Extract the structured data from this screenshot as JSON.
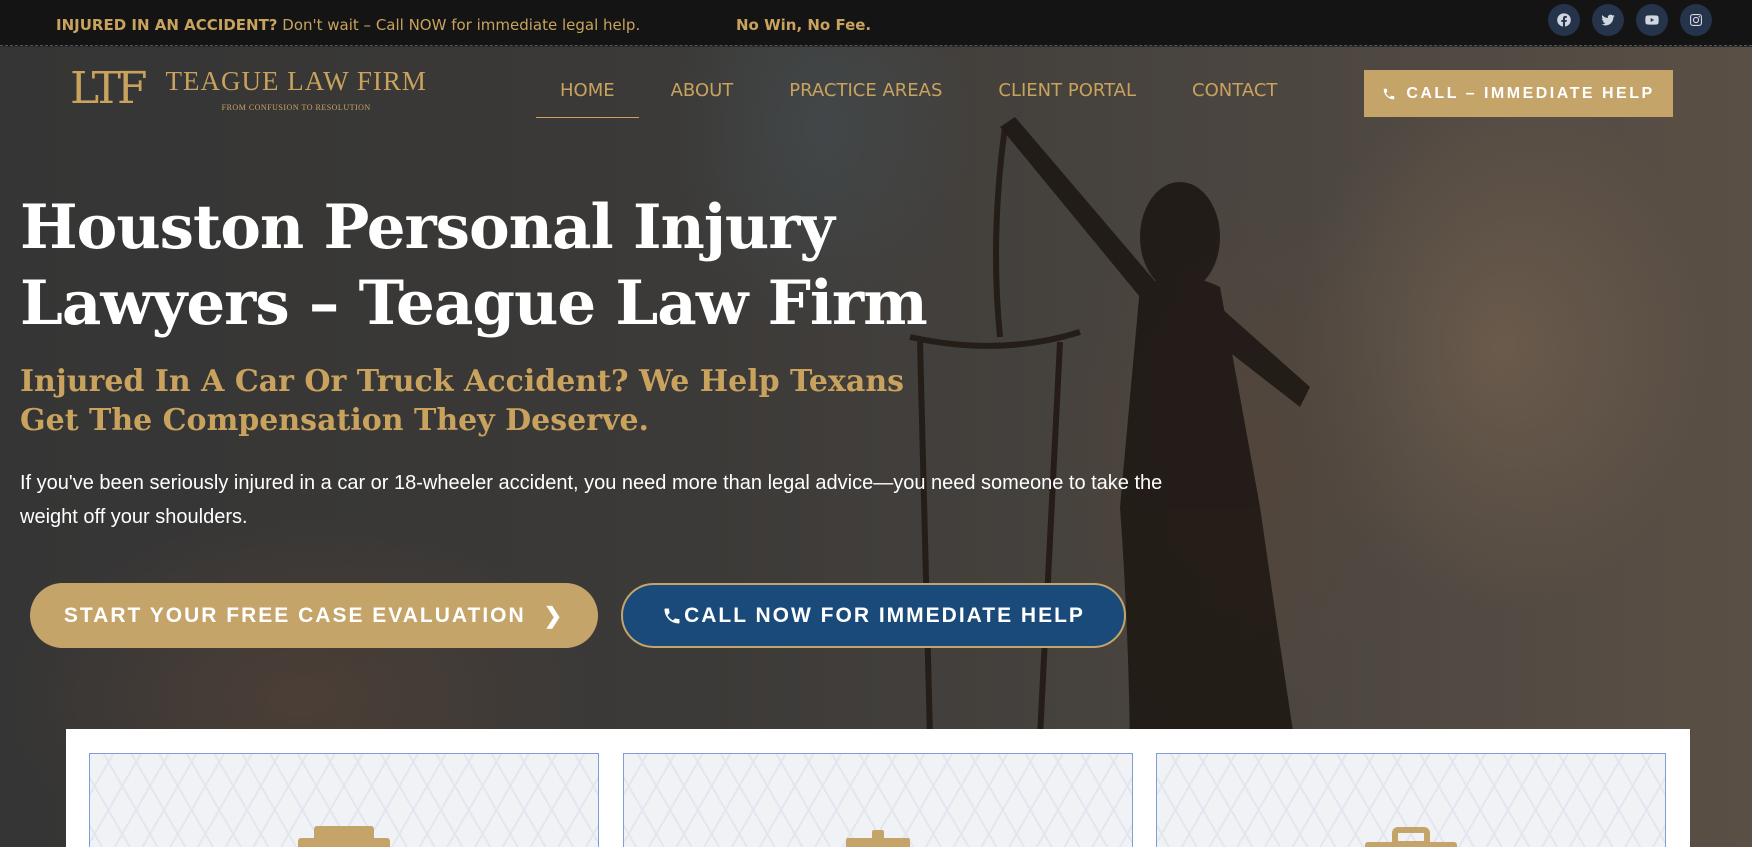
{
  "topbar": {
    "promo_bold": "INJURED IN AN ACCIDENT?",
    "promo_text": " Don't wait – Call NOW for immediate legal help.",
    "no_win": "No Win, No Fee.",
    "socials": [
      "facebook-icon",
      "twitter-icon",
      "youtube-icon",
      "instagram-icon"
    ]
  },
  "header": {
    "logo_monogram": "LTF",
    "logo_name": "TEAGUE LAW FIRM",
    "logo_tagline": "FROM CONFUSION TO RESOLUTION",
    "nav": [
      "HOME",
      "ABOUT",
      "PRACTICE AREAS",
      "CLIENT PORTAL",
      "CONTACT"
    ],
    "active_nav": "HOME",
    "call_label": "CALL – IMMEDIATE HELP"
  },
  "hero": {
    "title": "Houston Personal Injury Lawyers – Teague Law Firm",
    "subtitle": "Injured In A Car Or Truck Accident? We Help Texans Get The Compensation They Deserve.",
    "lead": "If you've been seriously injured in a car or 18-wheeler accident, you need more than legal advice—you need someone to take the weight off your shoulders.",
    "cta_primary": "START YOUR FREE CASE EVALUATION",
    "cta_secondary": "CALL NOW FOR IMMEDIATE HELP"
  },
  "cards": {
    "icons": [
      "clipboard-icon",
      "gavel-icon",
      "briefcase-icon"
    ]
  },
  "colors": {
    "gold": "#c5a46a",
    "navy": "#194a7a",
    "topbar_bg": "#141414"
  }
}
